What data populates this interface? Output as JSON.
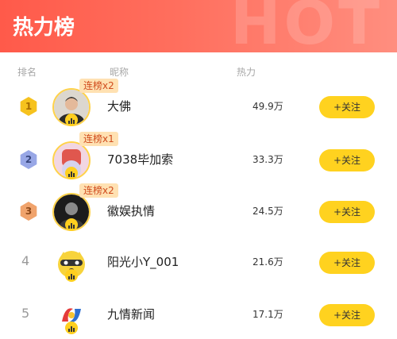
{
  "header": {
    "title": "热力榜",
    "bg_word": "HOT"
  },
  "columns": {
    "rank": "排名",
    "nickname": "昵称",
    "heat": "热力"
  },
  "follow_label": "+关注",
  "rows": [
    {
      "medal": "1",
      "streak": "连榜x2",
      "name": "大佛",
      "heat": "49.9万"
    },
    {
      "medal": "2",
      "streak": "连榜x1",
      "name": "7038毕加索",
      "heat": "33.3万"
    },
    {
      "medal": "3",
      "streak": "连榜x2",
      "name": "徽娱执情",
      "heat": "24.5万"
    },
    {
      "rank": "4",
      "name": "阳光小Y_001",
      "heat": "21.6万"
    },
    {
      "rank": "5",
      "name": "九情新闻",
      "heat": "17.1万"
    }
  ],
  "colors": {
    "header_start": "#ff5a4a",
    "header_end": "#ff8e7f",
    "follow_bg": "#ffd21f",
    "streak_bg": "#ffe1b2",
    "streak_text": "#d04b1d"
  }
}
